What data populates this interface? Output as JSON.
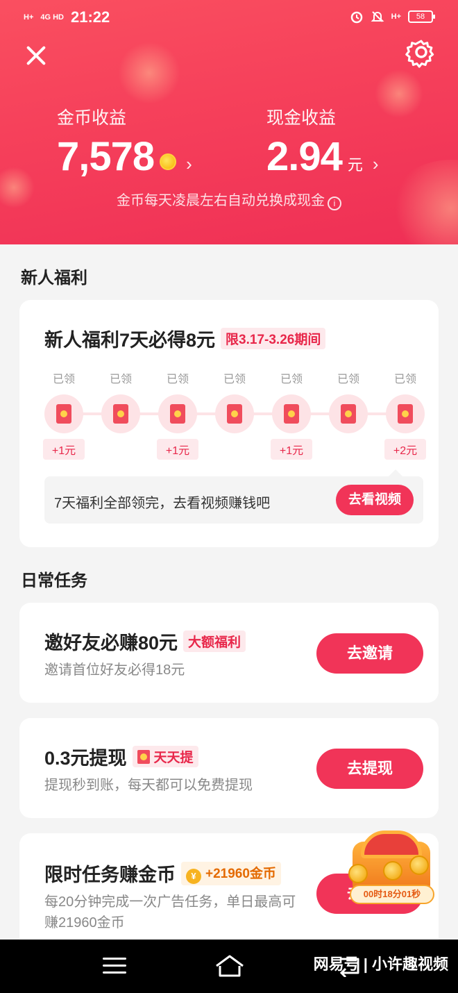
{
  "statusbar": {
    "signal1": "H+",
    "signal2": "4G HD",
    "time": "21:22",
    "network": "H+",
    "battery": "58"
  },
  "header": {
    "coin_label": "金币收益",
    "coin_value": "7,578",
    "cash_label": "现金收益",
    "cash_value": "2.94",
    "cash_unit": "元",
    "note": "金币每天凌晨左右自动兑换成现金"
  },
  "newbie": {
    "section_title": "新人福利",
    "title": "新人福利7天必得8元",
    "tag": "限3.17-3.26期间",
    "days": [
      {
        "status": "已领",
        "reward": "+1元"
      },
      {
        "status": "已领",
        "reward": ""
      },
      {
        "status": "已领",
        "reward": "+1元"
      },
      {
        "status": "已领",
        "reward": ""
      },
      {
        "status": "已领",
        "reward": "+1元"
      },
      {
        "status": "已领",
        "reward": ""
      },
      {
        "status": "已领",
        "reward": "+2元"
      }
    ],
    "footer_text": "7天福利全部领完，去看视频赚钱吧",
    "footer_button": "去看视频"
  },
  "daily": {
    "section_title": "日常任务",
    "tasks": [
      {
        "title": "邀好友必赚80元",
        "tag": "大额福利",
        "desc": "邀请首位好友必得18元",
        "button": "去邀请"
      },
      {
        "title": "0.3元提现",
        "tag": "天天提",
        "desc": "提现秒到账，每天都可以免费提现",
        "button": "去提现"
      },
      {
        "title": "限时任务赚金币",
        "tag": "+21960金币",
        "desc": "每20分钟完成一次广告任务，单日最高可赚21960金币",
        "button": "去完成"
      }
    ],
    "chest_timer": "00时18分01秒",
    "coin_symbol": "¥"
  },
  "navbar": {
    "watermark": "网易号 | 小许趣视频"
  },
  "colors": {
    "accent": "#f13458",
    "header_gradient_start": "#fa4f60",
    "header_gradient_end": "#ef2f55"
  }
}
